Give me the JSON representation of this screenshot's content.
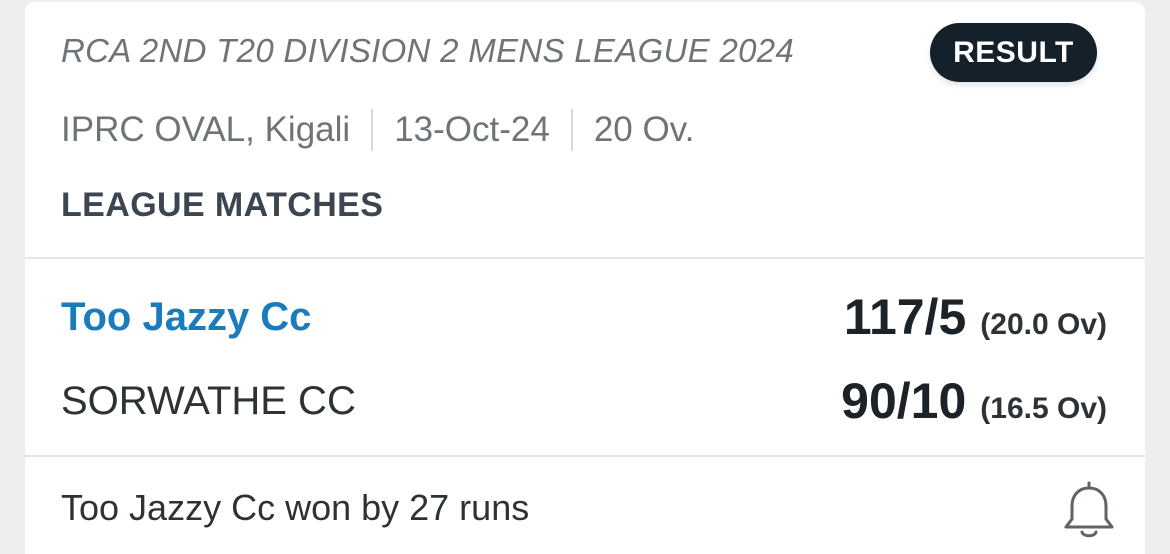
{
  "match": {
    "league": "RCA 2ND T20 DIVISION 2 MENS LEAGUE 2024",
    "status_badge": "RESULT",
    "venue": "IPRC OVAL, Kigali",
    "date": "13-Oct-24",
    "format": "20 Ov.",
    "stage": "LEAGUE MATCHES"
  },
  "teams": [
    {
      "name": "Too Jazzy Cc",
      "score": "117/5",
      "overs": "(20.0 Ov)",
      "winner": true
    },
    {
      "name": "SORWATHE CC",
      "score": "90/10",
      "overs": "(16.5 Ov)",
      "winner": false
    }
  ],
  "footer": {
    "result_text": "Too Jazzy Cc won by 27 runs",
    "icon": "bell-icon"
  },
  "colors": {
    "winner_team": "#1a7bbd",
    "badge_bg": "#14202a",
    "muted_text": "#6f7479"
  }
}
